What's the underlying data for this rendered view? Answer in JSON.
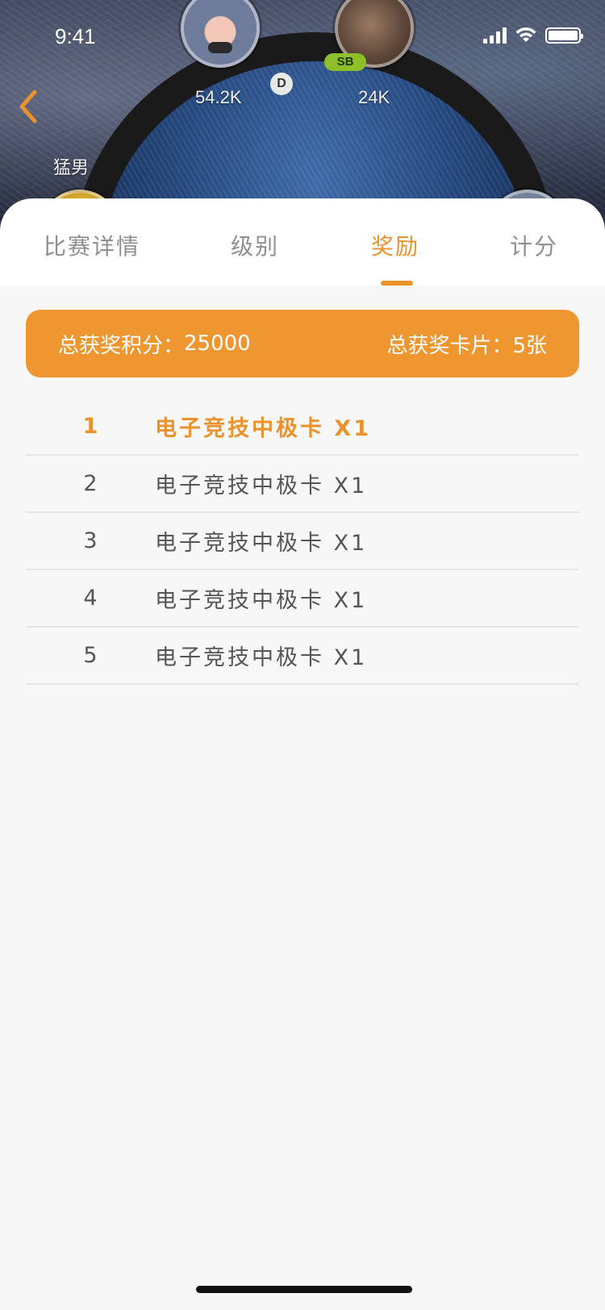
{
  "status_bar": {
    "time": "9:41"
  },
  "hero": {
    "players": [
      {
        "chips": "54.2K"
      },
      {
        "chips": "24K",
        "badge": "SB"
      },
      {
        "name": "猛男"
      }
    ],
    "dealer_label": "D"
  },
  "tabs": [
    {
      "label": "比赛详情",
      "active": false
    },
    {
      "label": "级别",
      "active": false
    },
    {
      "label": "奖励",
      "active": true
    },
    {
      "label": "计分",
      "active": false
    }
  ],
  "summary": {
    "total_points_label": "总获奖积分：",
    "total_points": "25000",
    "total_cards_label": "总获奖卡片：",
    "total_cards": "5张"
  },
  "rewards": [
    {
      "rank": "1",
      "prize": "电子竞技中极卡 X1"
    },
    {
      "rank": "2",
      "prize": "电子竞技中极卡 X1"
    },
    {
      "rank": "3",
      "prize": "电子竞技中极卡 X1"
    },
    {
      "rank": "4",
      "prize": "电子竞技中极卡 X1"
    },
    {
      "rank": "5",
      "prize": "电子竞技中极卡 X1"
    }
  ],
  "colors": {
    "accent": "#ea922c",
    "banner": "#ee9731",
    "background": "#f7f7f7"
  }
}
